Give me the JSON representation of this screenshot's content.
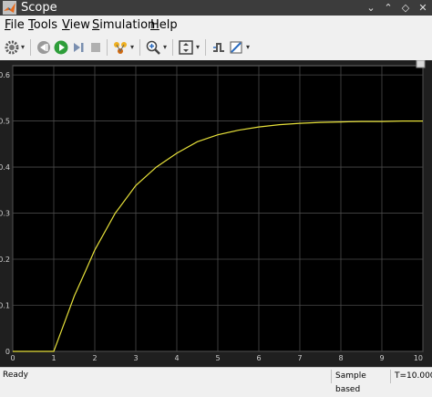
{
  "window": {
    "title": "Scope"
  },
  "menu": [
    {
      "label": "File",
      "mnemonic": "F",
      "rest": "ile"
    },
    {
      "label": "Tools",
      "mnemonic": "T",
      "rest": "ools"
    },
    {
      "label": "View",
      "mnemonic": "V",
      "rest": "iew"
    },
    {
      "label": "Simulation",
      "mnemonic": "S",
      "rest": "imulation"
    },
    {
      "label": "Help",
      "mnemonic": "H",
      "rest": "elp"
    }
  ],
  "toolbar_icons": [
    "gear-icon",
    "step-back-icon",
    "run-icon",
    "step-forward-icon",
    "stop-icon",
    "highlight-icon",
    "zoom-icon",
    "autoscale-icon",
    "triggers-icon",
    "style-icon"
  ],
  "status": {
    "text": "Ready",
    "sample_mode": "Sample based",
    "time": "T=10.000"
  },
  "colors": {
    "plot_bg": "#000000",
    "axes_bg": "#1f1f1f",
    "grid": "#4a4a4a",
    "line": "#e6e03a",
    "tick_text": "#d0d0d0"
  },
  "chart_data": {
    "type": "line",
    "title": "",
    "xlabel": "",
    "ylabel": "",
    "xlim": [
      0,
      10
    ],
    "ylim": [
      0,
      0.62
    ],
    "xticks": [
      0,
      1,
      2,
      3,
      4,
      5,
      6,
      7,
      8,
      9,
      10
    ],
    "xtick_labels": [
      "0",
      "1",
      "2",
      "3",
      "4",
      "5",
      "6",
      "7",
      "8",
      "9",
      "10"
    ],
    "yticks": [
      0,
      0.1,
      0.2,
      0.3,
      0.4,
      0.5,
      0.6
    ],
    "ytick_labels": [
      "0",
      "0.1",
      "0.2",
      "0.3",
      "0.4",
      "0.5",
      "0.6"
    ],
    "grid": true,
    "series": [
      {
        "x": [
          0,
          1,
          1.25,
          1.5,
          1.75,
          2,
          2.5,
          3,
          3.5,
          4,
          4.5,
          5,
          5.5,
          6,
          6.5,
          7,
          7.5,
          8,
          8.5,
          9,
          9.5,
          10
        ],
        "y": [
          0,
          0,
          0.06,
          0.12,
          0.17,
          0.22,
          0.3,
          0.36,
          0.4,
          0.43,
          0.455,
          0.47,
          0.48,
          0.487,
          0.492,
          0.495,
          0.497,
          0.498,
          0.499,
          0.499,
          0.5,
          0.5
        ]
      }
    ]
  }
}
